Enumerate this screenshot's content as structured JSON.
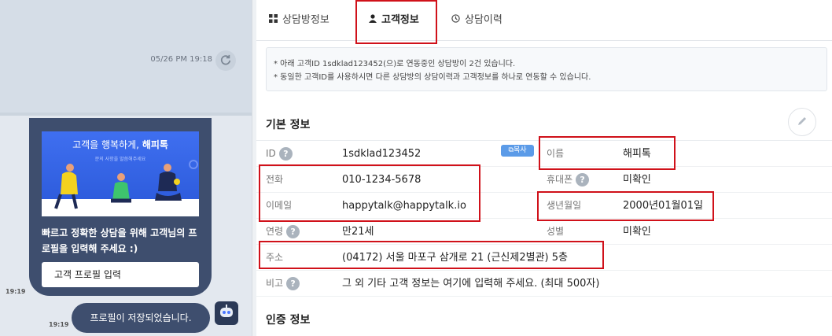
{
  "chat": {
    "timestamp": "05/26 PM 19:18",
    "banner_title_prefix": "고객을 행복하게,",
    "banner_title_brand": "해피톡",
    "banner_subtitle": "문의 사항을 말씀해주세요",
    "card_message": "빠르고 정확한 상담을 위해 고객님의 프로필을 입력해 주세요 :)",
    "profile_button_label": "고객 프로필 입력",
    "card_time": "19:19",
    "user_message": "프로필이 저장되었습니다.",
    "user_message_time": "19:19",
    "refresh_icon": "refresh-icon",
    "avatar_icon": "robot-icon"
  },
  "tabs": [
    {
      "label": "상담방정보",
      "icon": "grid-icon",
      "active": false
    },
    {
      "label": "고객정보",
      "icon": "person-icon",
      "active": true
    },
    {
      "label": "상담이력",
      "icon": "history-icon",
      "active": false
    }
  ],
  "notice": {
    "line1": "* 아래 고객ID 1sdklad123452(으)로 연동중인 상담방이 2건 있습니다.",
    "line2": "* 동일한 고객ID를 사용하시면 다른 상담방의 상담이력과 고객정보를 하나로 연동할 수 있습니다."
  },
  "basic_info": {
    "title": "기본 정보",
    "edit_icon": "pencil-icon",
    "copy_label": "복사",
    "fields": {
      "id": {
        "label": "ID",
        "value": "1sdklad123452"
      },
      "name": {
        "label": "이름",
        "value": "해피톡"
      },
      "phone": {
        "label": "전화",
        "value": "010-1234-5678"
      },
      "mobile": {
        "label": "휴대폰",
        "value": "미확인"
      },
      "email": {
        "label": "이메일",
        "value": "happytalk@happytalk.io"
      },
      "birth": {
        "label": "생년월일",
        "value": "2000년01월01일"
      },
      "age": {
        "label": "연령",
        "value": "만21세"
      },
      "gender": {
        "label": "성별",
        "value": "미확인"
      },
      "address": {
        "label": "주소",
        "value": "(04172) 서울 마포구 삼개로 21 (근신제2별관) 5층"
      },
      "note": {
        "label": "비고",
        "value": "그 외 기타 고객 정보는 여기에 입력해 주세요. (최대 500자)"
      }
    },
    "help_glyph": "?"
  },
  "auth_info": {
    "title": "인증 정보"
  },
  "colors": {
    "highlight": "#d0111a",
    "chat_card": "#3e4e6e",
    "banner": "#2a58d8",
    "copy_button": "#5b9be8"
  }
}
